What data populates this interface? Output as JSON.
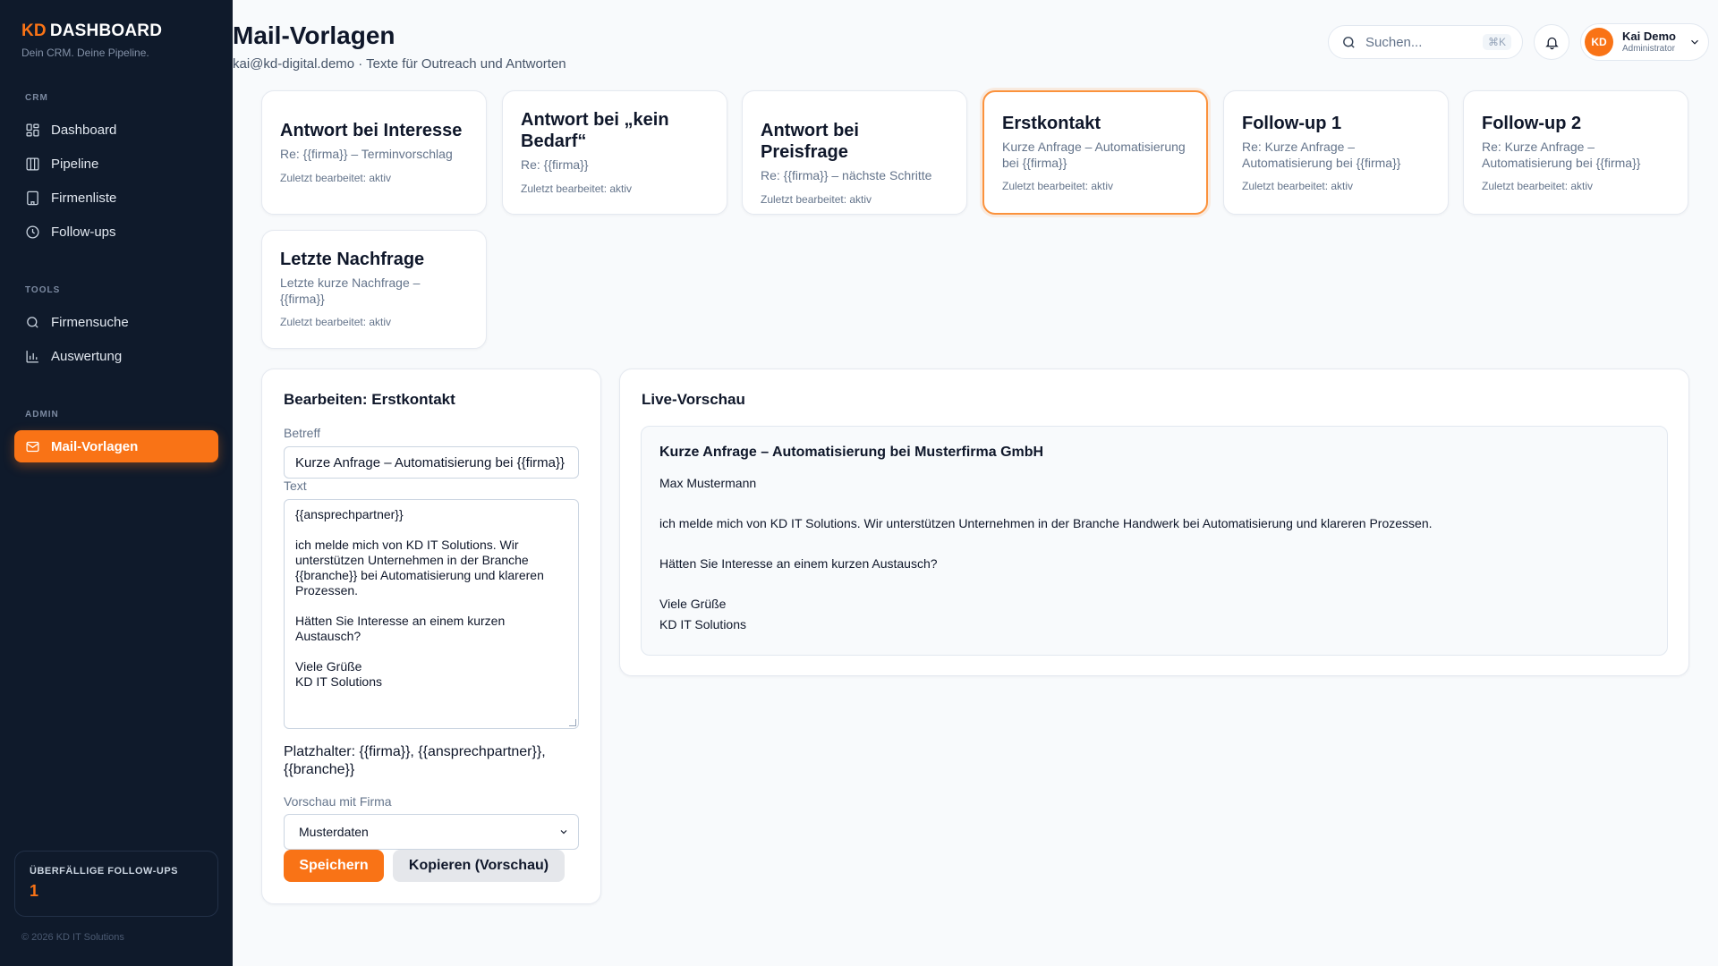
{
  "sidebar": {
    "brand_mark": "KD",
    "brand_name": "DASHBOARD",
    "tagline": "Dein CRM. Deine Pipeline.",
    "sections": {
      "crm": "CRM",
      "tools": "TOOLS",
      "admin": "ADMIN"
    },
    "items": {
      "dashboard": "Dashboard",
      "pipeline": "Pipeline",
      "companies": "Firmenliste",
      "followups": "Follow-ups",
      "company_search": "Firmensuche",
      "analytics": "Auswertung",
      "mail_templates": "Mail-Vorlagen"
    },
    "overdue_label": "ÜBERFÄLLIGE FOLLOW-UPS",
    "overdue_count": "1",
    "copyright": "© 2026 KD IT Solutions"
  },
  "header": {
    "title": "Mail-Vorlagen",
    "subtitle": "kai@kd-digital.demo · Texte für Outreach und Antworten",
    "search_placeholder": "Suchen...",
    "search_shortcut": "⌘K",
    "user_initials": "KD",
    "user_name": "Kai Demo",
    "user_role": "Administrator"
  },
  "templates": [
    {
      "title": "Antwort bei Interesse",
      "subject": "Re: {{firma}} – Terminvorschlag",
      "edited": "Zuletzt bearbeitet: aktiv"
    },
    {
      "title": "Antwort bei „kein Bedarf“",
      "subject": "Re: {{firma}}",
      "edited": "Zuletzt bearbeitet: aktiv"
    },
    {
      "title": "Antwort bei Preisfrage",
      "subject": "Re: {{firma}} – nächste Schritte",
      "edited": "Zuletzt bearbeitet: aktiv"
    },
    {
      "title": "Erstkontakt",
      "subject": "Kurze Anfrage – Automatisierung bei {{firma}}",
      "edited": "Zuletzt bearbeitet: aktiv"
    },
    {
      "title": "Follow-up 1",
      "subject": "Re: Kurze Anfrage – Automatisierung bei {{firma}}",
      "edited": "Zuletzt bearbeitet: aktiv"
    },
    {
      "title": "Follow-up 2",
      "subject": "Re: Kurze Anfrage – Automatisierung bei {{firma}}",
      "edited": "Zuletzt bearbeitet: aktiv"
    },
    {
      "title": "Letzte Nachfrage",
      "subject": "Letzte kurze Nachfrage – {{firma}}",
      "edited": "Zuletzt bearbeitet: aktiv"
    }
  ],
  "editor": {
    "title": "Bearbeiten: Erstkontakt",
    "subject_label": "Betreff",
    "subject_value": "Kurze Anfrage – Automatisierung bei {{firma}}",
    "text_label": "Text",
    "text_value": "{{ansprechpartner}}\n\nich melde mich von KD IT Solutions. Wir unterstützen Unternehmen in der Branche {{branche}} bei Automatisierung und klareren Prozessen.\n\nHätten Sie Interesse an einem kurzen Austausch?\n\nViele Grüße\nKD IT Solutions",
    "placeholder_hint": "Platzhalter: {{firma}}, {{ansprechpartner}}, {{branche}}",
    "preview_company_label": "Vorschau mit Firma",
    "preview_company_value": "Musterdaten",
    "save_label": "Speichern",
    "copy_label": "Kopieren (Vorschau)"
  },
  "preview": {
    "title": "Live-Vorschau",
    "subject": "Kurze Anfrage – Automatisierung bei Musterfirma GmbH",
    "body": "Max Mustermann\n\nich melde mich von KD IT Solutions. Wir unterstützen Unternehmen in der Branche Handwerk bei Automatisierung und klareren Prozessen.\n\nHätten Sie Interesse an einem kurzen Austausch?\n\nViele Grüße\nKD IT Solutions"
  },
  "colors": {
    "accent": "#f97316",
    "sidebar_bg": "#0f1a2b",
    "page_bg": "#f8fafc"
  }
}
